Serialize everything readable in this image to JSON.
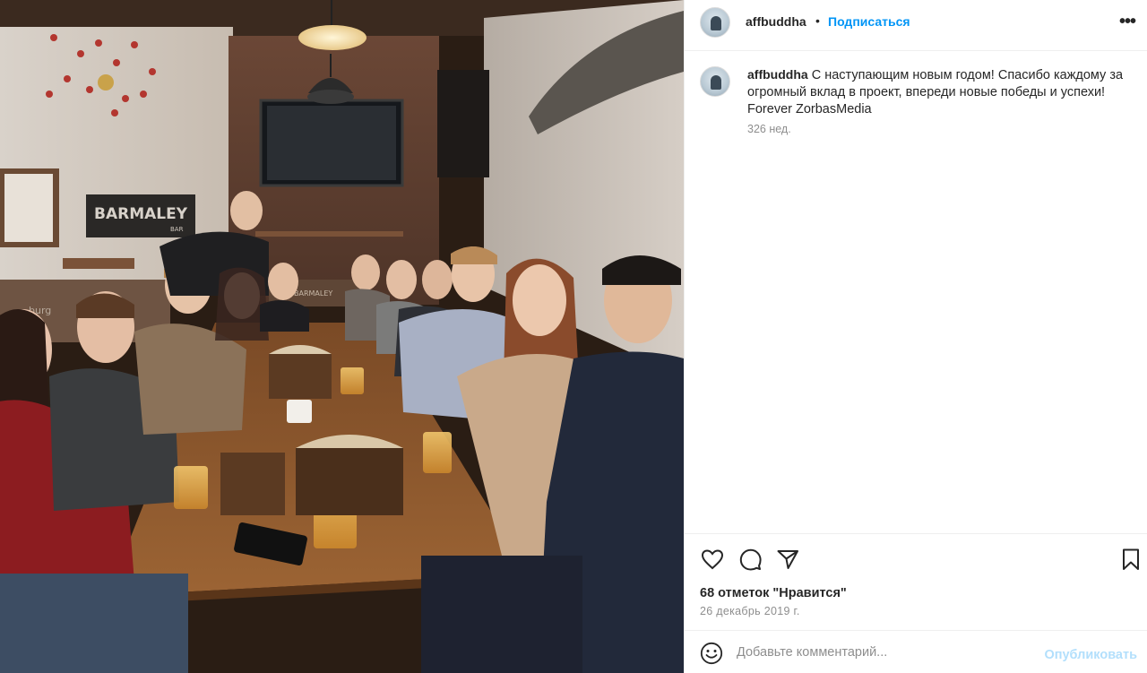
{
  "header": {
    "username": "affbuddha",
    "separator": "•",
    "follow_label": "Подписаться",
    "more_icon": "more-horizontal-icon"
  },
  "post": {
    "author": "affbuddha",
    "caption_text": "С наступающим новым годом! Спасибо каждому за огромный вклад в проект, впереди новые победы и успехи! Forever ZorbasMedia",
    "age": "326 нед."
  },
  "photo": {
    "sign_text": "BARMALEY",
    "sign_sub": "BAR",
    "wall_text": "burg",
    "shelf_text": "BARMALEY"
  },
  "actions": {
    "like_icon": "heart-icon",
    "comment_icon": "comment-icon",
    "share_icon": "share-icon",
    "save_icon": "bookmark-icon",
    "likes_text": "68 отметок \"Нравится\"",
    "date_text": "26 декабрь 2019 г."
  },
  "comment_box": {
    "emoji_icon": "smiley-icon",
    "placeholder": "Добавьте комментарий...",
    "publish_label": "Опубликовать"
  },
  "colors": {
    "link_blue": "#0095f6",
    "publish_disabled": "#b2dffc",
    "muted_text": "#8e8e8e"
  }
}
